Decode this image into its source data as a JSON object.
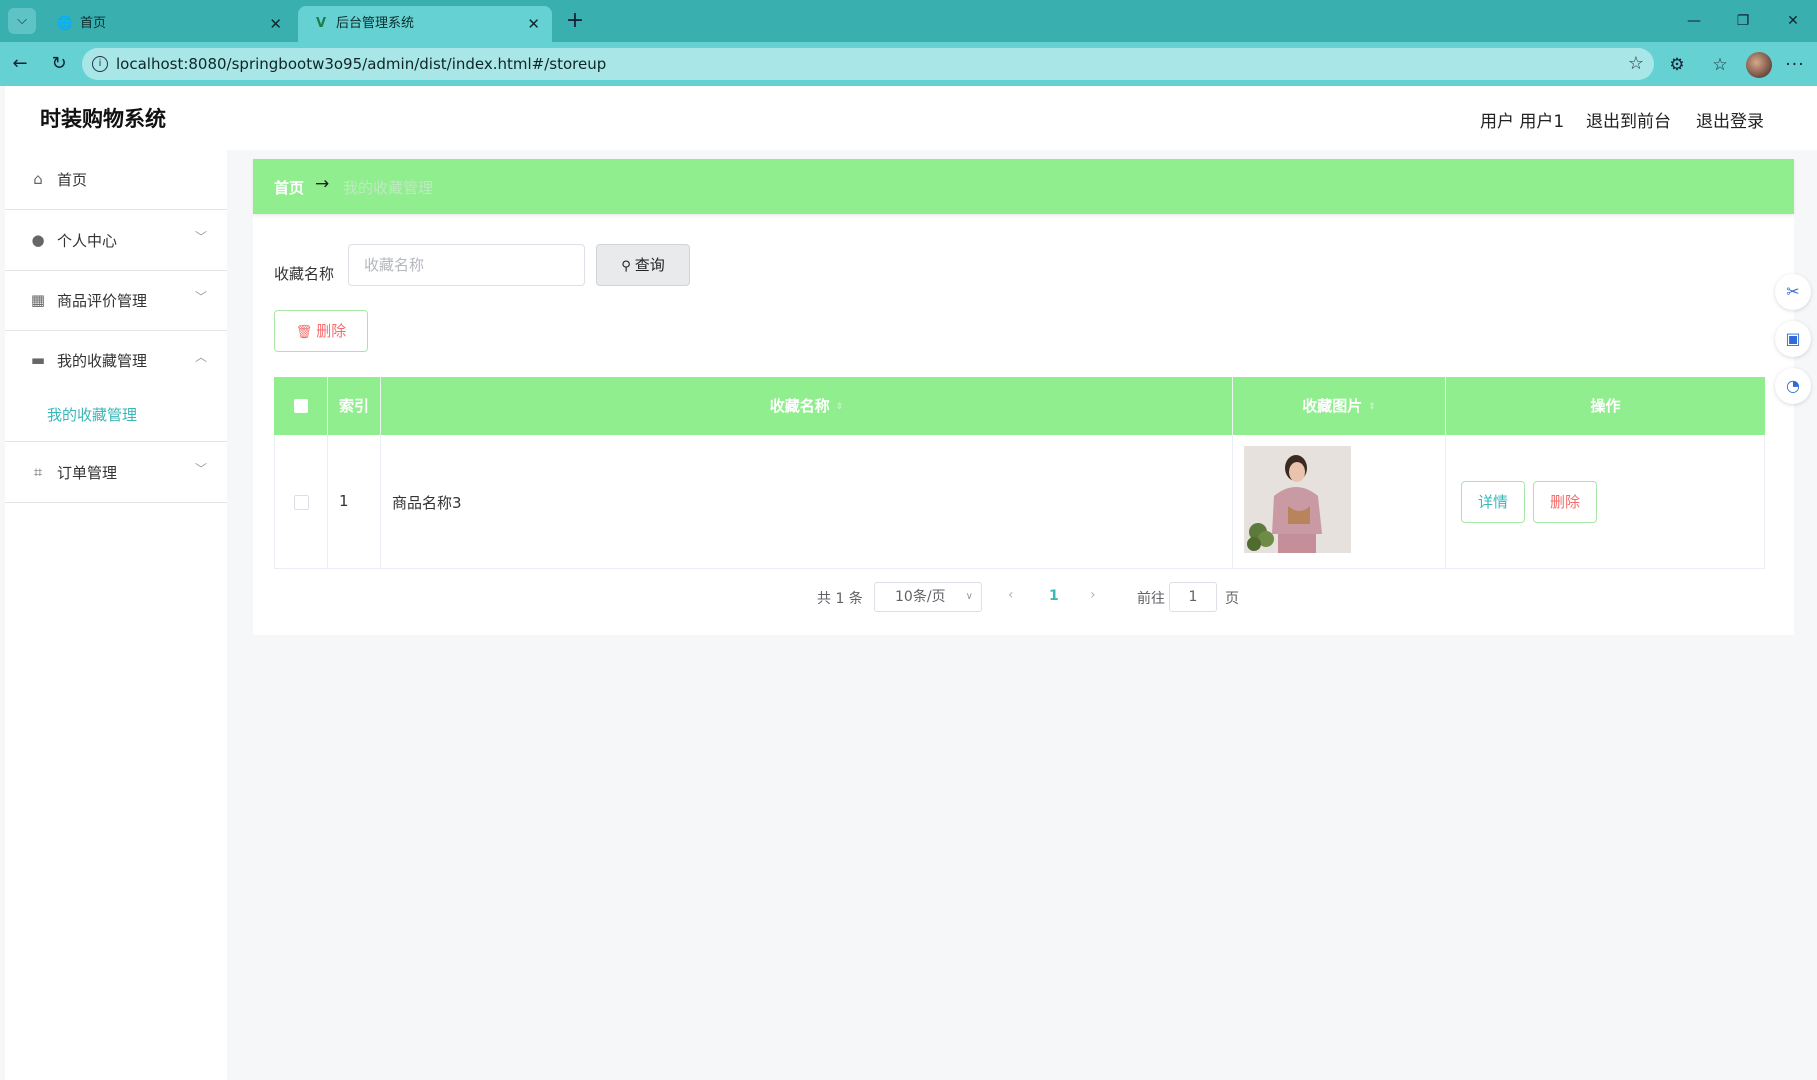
{
  "browser": {
    "tabs": [
      {
        "title": "首页",
        "icon": "globe-icon"
      },
      {
        "title": "后台管理系统",
        "icon": "vue-logo-icon"
      }
    ],
    "url": "localhost:8080/springbootw3o95/admin/dist/index.html#/storeup"
  },
  "app": {
    "title": "时装购物系统",
    "header_links": {
      "user": "用户 用户1",
      "front": "退出到前台",
      "logout": "退出登录"
    }
  },
  "sidebar": {
    "items": [
      {
        "label": "首页",
        "icon": "home-icon"
      },
      {
        "label": "个人中心",
        "icon": "user-icon"
      },
      {
        "label": "商品评价管理",
        "icon": "grid-icon"
      },
      {
        "label": "我的收藏管理",
        "icon": "briefcase-icon"
      },
      {
        "label": "订单管理",
        "icon": "crop-icon"
      }
    ],
    "sub_item": "我的收藏管理"
  },
  "breadcrumb": {
    "home": "首页",
    "arrow": "→",
    "current": "我的收藏管理"
  },
  "search": {
    "label": "收藏名称",
    "placeholder": "收藏名称",
    "button": "查询"
  },
  "actions": {
    "delete": "删除"
  },
  "table": {
    "headers": {
      "index": "索引",
      "name": "收藏名称",
      "image": "收藏图片",
      "ops": "操作"
    },
    "rows": [
      {
        "index": "1",
        "name": "商品名称3",
        "detail": "详情",
        "delete": "删除"
      }
    ]
  },
  "pagination": {
    "total": "共 1 条",
    "page_size": "10条/页",
    "current": "1",
    "goto": "前往",
    "goto_value": "1",
    "page_unit": "页"
  },
  "colors": {
    "accent": "#90ee8f",
    "link": "#3ab7b8",
    "danger": "#f56c6c",
    "browser": "#66d1d2"
  }
}
